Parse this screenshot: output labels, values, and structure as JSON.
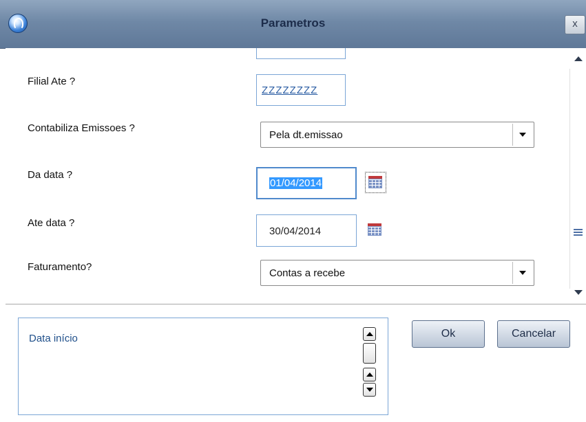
{
  "window": {
    "title": "Parametros",
    "close_label": "x"
  },
  "fields": {
    "filial_ate": {
      "label": "Filial Ate  ?",
      "value": "ZZZZZZZZ"
    },
    "contabiliza": {
      "label": "Contabiliza Emissoes ?",
      "value": "Pela dt.emissao"
    },
    "da_data": {
      "label": "Da data ?",
      "value": "01/04/2014"
    },
    "ate_data": {
      "label": "Ate data ?",
      "value": "30/04/2014"
    },
    "faturamento": {
      "label": "Faturamento?",
      "value": "Contas a recebe"
    }
  },
  "help": {
    "text": "Data início"
  },
  "buttons": {
    "ok": "Ok",
    "cancel": "Cancelar"
  },
  "icons": {
    "app": "totvs-app-icon",
    "calendar": "calendar-icon",
    "close": "close-icon"
  },
  "colors": {
    "titlebar": "#6f88a6",
    "input_border": "#7aa5d6",
    "selection": "#3399ff",
    "calendar_header": "#c0393b"
  }
}
